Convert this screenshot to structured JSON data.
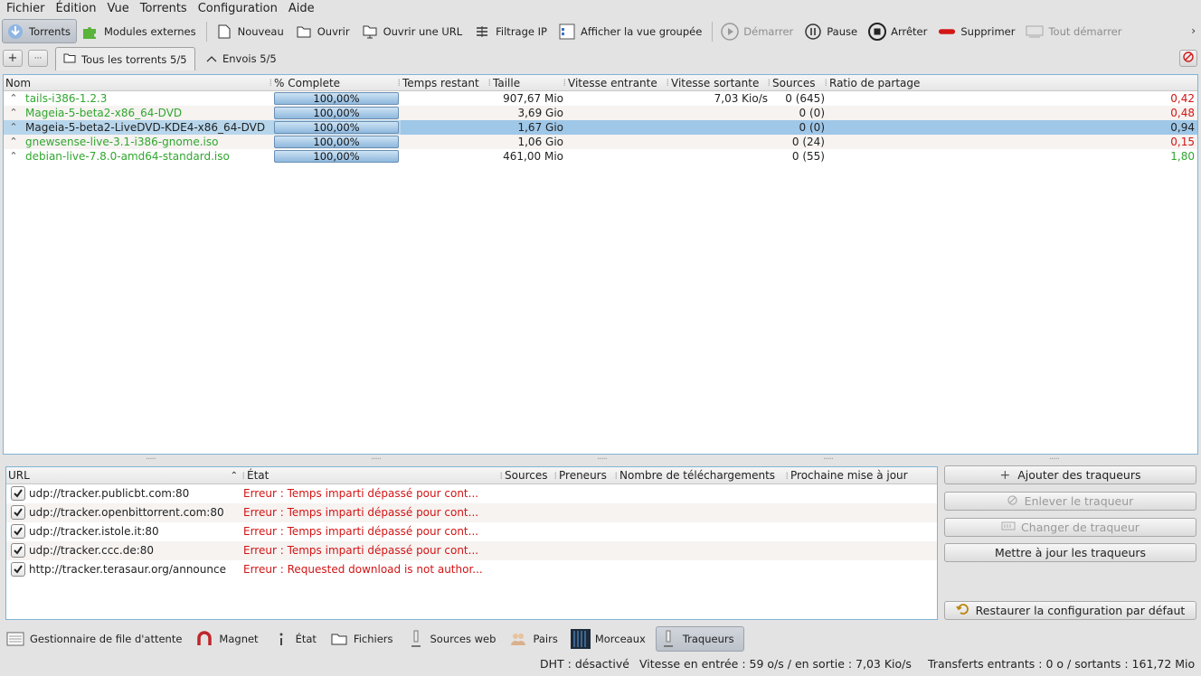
{
  "menu": [
    "Fichier",
    "Édition",
    "Vue",
    "Torrents",
    "Configuration",
    "Aide"
  ],
  "toolbar": {
    "torrents": "Torrents",
    "plugins": "Modules externes",
    "new": "Nouveau",
    "open": "Ouvrir",
    "open_url": "Ouvrir une URL",
    "ip_filter": "Filtrage IP",
    "grouped_view": "Afficher la vue groupée",
    "start": "Démarrer",
    "pause": "Pause",
    "stop": "Arrêter",
    "remove": "Supprimer",
    "start_all": "Tout démarrer",
    "more": "›"
  },
  "group_tabs": {
    "add": "+",
    "more": "···",
    "all": "Tous les torrents 5/5",
    "uploads": "Envois 5/5"
  },
  "columns": [
    "Nom",
    "% Complete",
    "Temps restant",
    "Taille",
    "Vitesse entrante",
    "Vitesse sortante",
    "Sources",
    "Ratio de partage"
  ],
  "torrents": [
    {
      "name": "tails-i386-1.2.3",
      "complete": "100,00%",
      "remaining": "",
      "size": "907,67 Mio",
      "down": "",
      "up": "7,03 Kio/s",
      "sources": "0 (645)",
      "ratio": "0,42",
      "name_color": "green",
      "ratio_color": "red"
    },
    {
      "name": "Mageia-5-beta2-x86_64-DVD",
      "complete": "100,00%",
      "remaining": "",
      "size": "3,69 Gio",
      "down": "",
      "up": "",
      "sources": "0 (0)",
      "ratio": "0,48",
      "name_color": "green",
      "ratio_color": "red"
    },
    {
      "name": "Mageia-5-beta2-LiveDVD-KDE4-x86_64-DVD",
      "complete": "100,00%",
      "remaining": "",
      "size": "1,67 Gio",
      "down": "",
      "up": "",
      "sources": "0 (0)",
      "ratio": "0,94",
      "name_color": "default",
      "ratio_color": "default"
    },
    {
      "name": "gnewsense-live-3.1-i386-gnome.iso",
      "complete": "100,00%",
      "remaining": "",
      "size": "1,06 Gio",
      "down": "",
      "up": "",
      "sources": "0 (24)",
      "ratio": "0,15",
      "name_color": "green",
      "ratio_color": "red"
    },
    {
      "name": "debian-live-7.8.0-amd64-standard.iso",
      "complete": "100,00%",
      "remaining": "",
      "size": "461,00 Mio",
      "down": "",
      "up": "",
      "sources": "0 (55)",
      "ratio": "1,80",
      "name_color": "green",
      "ratio_color": "green"
    }
  ],
  "tracker_columns": [
    "URL",
    "État",
    "Sources",
    "Preneurs",
    "Nombre de téléchargements",
    "Prochaine mise à jour"
  ],
  "trackers": [
    {
      "url": "udp://tracker.publicbt.com:80",
      "state": "Erreur : Temps imparti dépassé pour cont..."
    },
    {
      "url": "udp://tracker.openbittorrent.com:80",
      "state": "Erreur : Temps imparti dépassé pour cont..."
    },
    {
      "url": "udp://tracker.istole.it:80",
      "state": "Erreur : Temps imparti dépassé pour cont..."
    },
    {
      "url": "udp://tracker.ccc.de:80",
      "state": "Erreur : Temps imparti dépassé pour cont..."
    },
    {
      "url": "http://tracker.terasaur.org/announce",
      "state": "Erreur : Requested download is not author..."
    }
  ],
  "tracker_buttons": {
    "add": "Ajouter des traqueurs",
    "remove": "Enlever le traqueur",
    "change": "Changer de traqueur",
    "update": "Mettre à jour les traqueurs",
    "restore": "Restaurer la configuration par défaut"
  },
  "bottom_tabs": [
    "Gestionnaire de file d'attente",
    "Magnet",
    "État",
    "Fichiers",
    "Sources web",
    "Pairs",
    "Morceaux",
    "Traqueurs"
  ],
  "status": {
    "dht": "DHT : désactivé",
    "speed": "Vitesse en entrée : 59 o/s / en sortie : 7,03 Kio/s",
    "transfers": "Transferts entrants : 0 o / sortants : 161,72 Mio"
  },
  "colors": {
    "green": "#31a62f",
    "red": "#d21414",
    "selection": "#b7d6ec",
    "accent": "#7fb4d6"
  }
}
